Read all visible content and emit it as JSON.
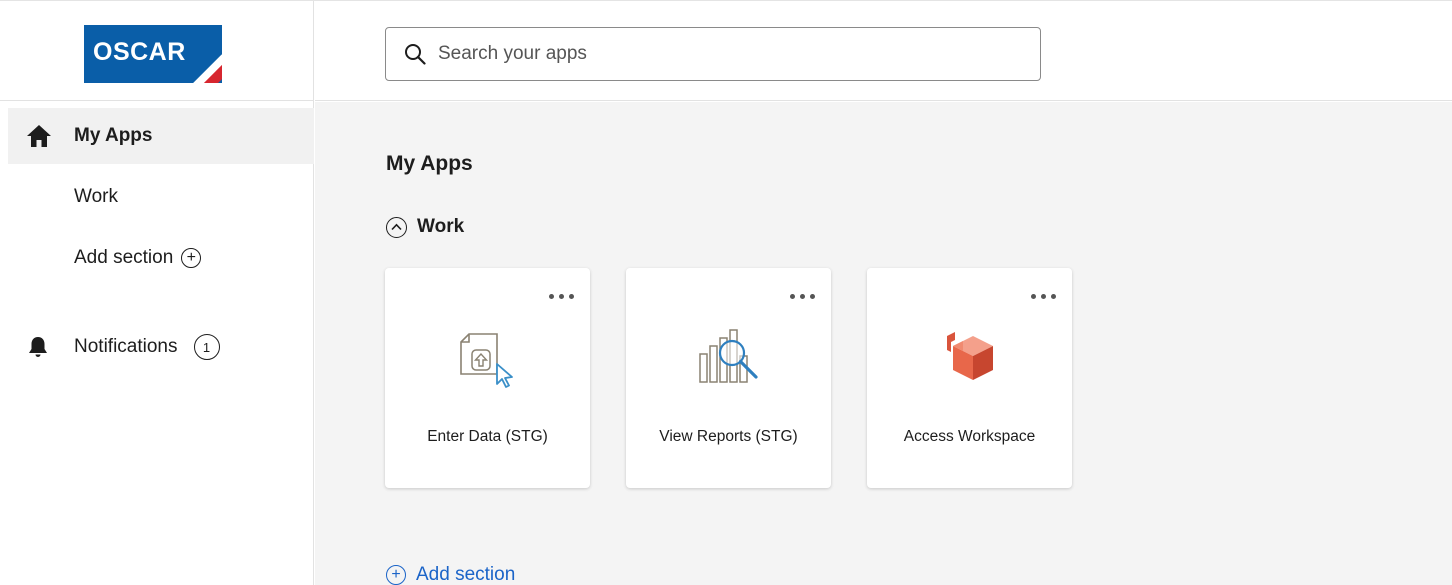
{
  "logo": {
    "text": "OSCAR"
  },
  "sidebar": {
    "items": [
      {
        "label": "My Apps",
        "icon": "home-icon",
        "active": true
      },
      {
        "label": "Work"
      },
      {
        "label": "Add section",
        "icon": "plus-circle-icon"
      },
      {
        "label": "Notifications",
        "icon": "bell-icon",
        "badge": "1"
      }
    ]
  },
  "search": {
    "placeholder": "Search your apps",
    "value": ""
  },
  "main": {
    "title": "My Apps",
    "section": {
      "label": "Work",
      "icon": "chevron-up-circle-icon"
    },
    "cards": [
      {
        "label": "Enter Data (STG)",
        "icon": "upload-document-icon"
      },
      {
        "label": "View Reports (STG)",
        "icon": "report-magnifier-icon"
      },
      {
        "label": "Access Workspace",
        "icon": "cube-icon"
      }
    ],
    "add_section": "Add section"
  },
  "colors": {
    "brand_blue": "#0a5ea8",
    "brand_red": "#d7262f",
    "link_blue": "#1b64c8",
    "cube_orange": "#e8674a"
  }
}
